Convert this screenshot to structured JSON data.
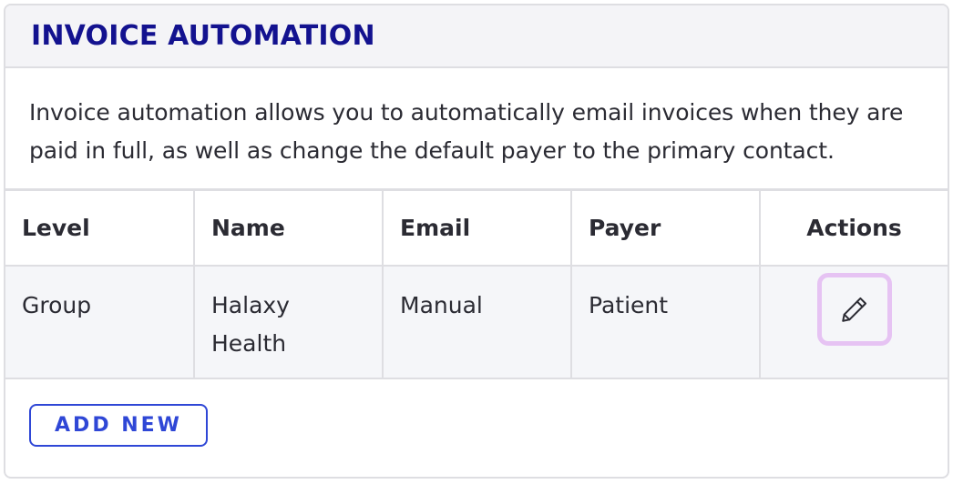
{
  "card": {
    "title": "INVOICE AUTOMATION",
    "description": "Invoice automation allows you to automatically email invoices when they are paid in full, as well as change the default payer to the primary contact."
  },
  "table": {
    "headers": {
      "level": "Level",
      "name": "Name",
      "email": "Email",
      "payer": "Payer",
      "actions": "Actions"
    },
    "rows": [
      {
        "level": "Group",
        "name": "Halaxy Health",
        "email": "Manual",
        "payer": "Patient",
        "actions": [
          "pencil-icon"
        ]
      }
    ]
  },
  "footer": {
    "add_new_label": "ADD NEW"
  },
  "colors": {
    "title": "#13128f",
    "accent": "#2f47d6",
    "edit_highlight": "#e6c3f3",
    "border": "#dedee2"
  }
}
